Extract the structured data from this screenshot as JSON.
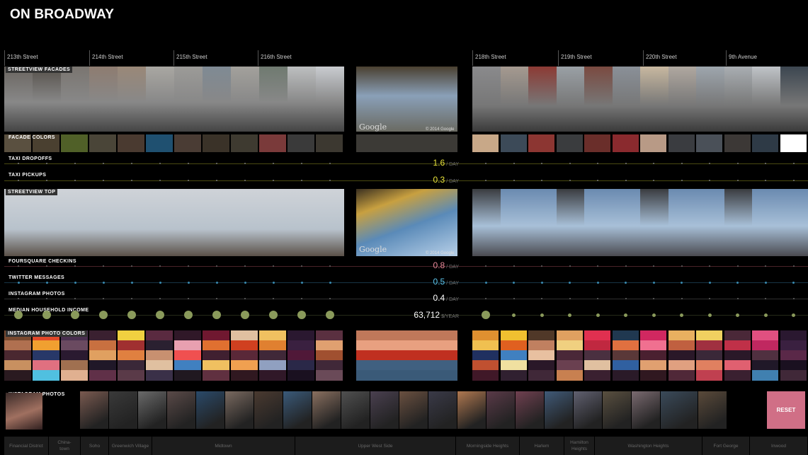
{
  "app": {
    "title": "ON BROADWAY"
  },
  "streets": [
    "213th Street",
    "214th Street",
    "215th Street",
    "216th Street",
    "218th Street",
    "219th Street",
    "220th Street",
    "9th Avenue"
  ],
  "sections": {
    "facades": "STREETVIEW FACADES",
    "facade_colors": "FACADE COLORS",
    "taxi_dropoffs": "TAXI DROPOFFS",
    "taxi_pickups": "TAXI PICKUPS",
    "streetview_top": "STREETVIEW TOP",
    "foursquare": "FOURSQUARE CHECKINS",
    "twitter": "TWITTER MESSAGES",
    "instagram_photos_row": "INSTAGRAM PHOTOS",
    "income": "MEDIAN HOUSEHOLD INCOME",
    "photo_colors": "INSTAGRAM PHOTO COLORS",
    "instagram_photos": "INSTAGRAM PHOTOS"
  },
  "metrics": {
    "taxi_dropoffs": {
      "value": "1.6",
      "unit": "/ DAY",
      "color": "#e8e23a"
    },
    "taxi_pickups": {
      "value": "0.3",
      "unit": "/ DAY",
      "color": "#e8e23a"
    },
    "foursquare": {
      "value": "0.8",
      "unit": "/ DAY",
      "color": "#e98a9a"
    },
    "twitter": {
      "value": "0.5",
      "unit": "/ DAY",
      "color": "#5ec8ef"
    },
    "instagram": {
      "value": "0.4",
      "unit": "/ DAY",
      "color": "#ffffff"
    },
    "income": {
      "value": "63,712",
      "unit": "$/YEAR",
      "color": "#ffffff"
    }
  },
  "google": {
    "logo": "Google",
    "copyright": "© 2014 Google"
  },
  "reset_label": "RESET",
  "neighborhoods": [
    "Financial District",
    "China-\ntown",
    "Soho",
    "Greenwich Village",
    "Midtown",
    "Upper West Side",
    "Morningside Heights",
    "Harlem",
    "Hamilton\nHeights",
    "Washington Heights",
    "Fort George",
    "Inwood"
  ],
  "colors": {
    "accent_reset": "#d06f86",
    "taxi": "#e8e23a",
    "foursquare": "#e98a9a",
    "twitter": "#5ec8ef",
    "income_dot": "#8a9a5b"
  }
}
